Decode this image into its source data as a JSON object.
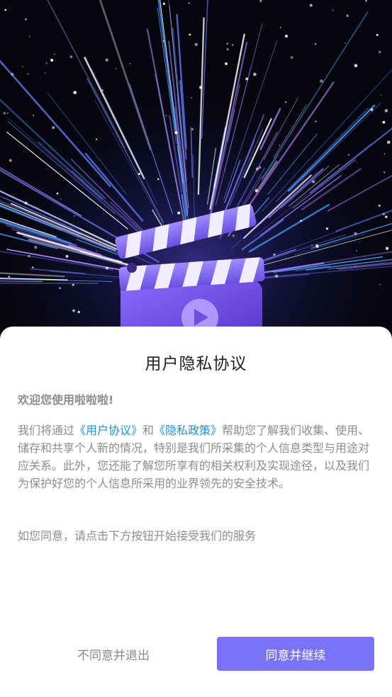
{
  "dialog": {
    "title": "用户隐私协议",
    "welcome": "欢迎您使用啦啦啦!",
    "body_prefix": "我们将通过",
    "user_agreement_link": "《用户协议》",
    "conjunction": "和",
    "privacy_policy_link": "《隐私政策》",
    "body_suffix": "帮助您了解我们收集、使用、储存和共享个人新的情况，特别是我们所采集的个人信息类型与用途对应关系。此外，您还能了解您所享有的相关权利及实现途径，以及我们为保护好您的个人信息所采用的业界领先的安全技术。",
    "consent_note": "如您同意，请点击下方按钮开始接受我们的服务"
  },
  "buttons": {
    "decline_label": "不同意并退出",
    "agree_label": "同意并继续"
  },
  "colors": {
    "accent": "#7a73f7",
    "link": "#1e8fe3",
    "text_muted": "#8d8d8d",
    "title": "#222222"
  },
  "hero": {
    "icon": "movie-clapperboard-icon"
  }
}
